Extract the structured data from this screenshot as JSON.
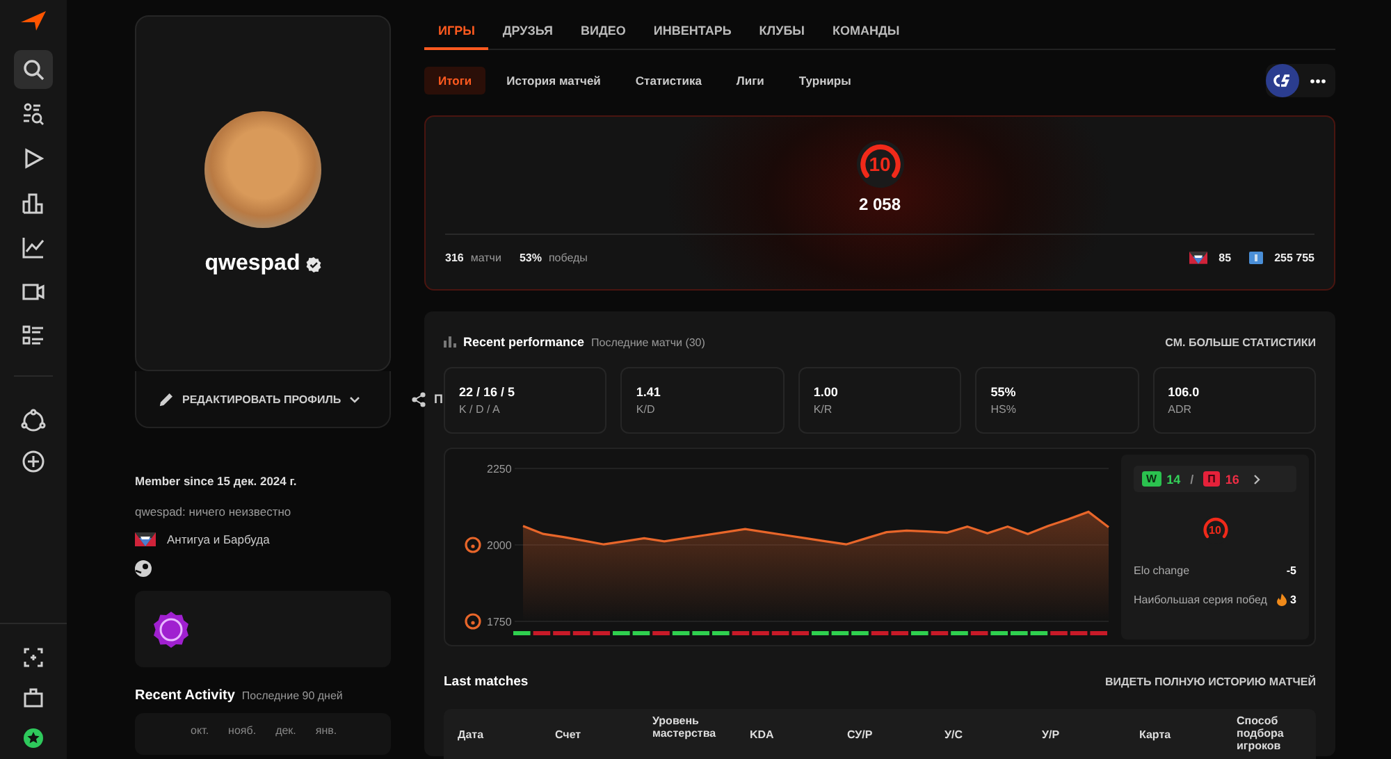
{
  "sidebar": {
    "items": [
      {
        "kind": "search",
        "selected": true
      },
      {
        "kind": "find",
        "selected": false
      },
      {
        "kind": "play",
        "selected": false
      },
      {
        "kind": "ranking",
        "selected": false
      },
      {
        "kind": "stats",
        "selected": false
      },
      {
        "kind": "video",
        "selected": false
      },
      {
        "kind": "list",
        "selected": false
      }
    ],
    "middle_items": [
      {
        "kind": "hub",
        "selected": false
      },
      {
        "kind": "add",
        "selected": false
      }
    ],
    "bottom_items": [
      {
        "kind": "scan",
        "selected": false
      },
      {
        "kind": "bag",
        "selected": false
      },
      {
        "kind": "star",
        "selected": false
      }
    ]
  },
  "profile": {
    "nickname": "qwespad",
    "verified": true,
    "edit_button": "РЕДАКТИРОВАТЬ ПРОФИЛЬ",
    "share_label": "П",
    "member_since": "Member since 15 дек. 2024 г.",
    "bio": "qwespad: ничего неизвестно",
    "country": "Антигуа и Барбуда"
  },
  "recent_activity": {
    "title": "Recent Activity",
    "subtitle": "Последние 90 дней",
    "months": [
      "окт.",
      "нояб.",
      "дек.",
      "янв."
    ]
  },
  "tabs": [
    {
      "label": "ИГРЫ",
      "selected": true
    },
    {
      "label": "ДРУЗЬЯ",
      "selected": false
    },
    {
      "label": "ВИДЕО",
      "selected": false
    },
    {
      "label": "ИНВЕНТАРЬ",
      "selected": false
    },
    {
      "label": "КЛУБЫ",
      "selected": false
    },
    {
      "label": "КОМАНДЫ",
      "selected": false
    }
  ],
  "subtabs": [
    {
      "label": "Итоги",
      "selected": true
    },
    {
      "label": "История матчей",
      "selected": false
    },
    {
      "label": "Статистика",
      "selected": false
    },
    {
      "label": "Лиги",
      "selected": false
    },
    {
      "label": "Турниры",
      "selected": false
    }
  ],
  "elo_card": {
    "level": "10",
    "elo": "2 058",
    "matches": "316",
    "matches_label": "матчи",
    "winrate": "53%",
    "winrate_label": "победы",
    "country_rank": "85",
    "region_rank": "255 755"
  },
  "performance": {
    "title": "Recent performance",
    "subtitle": "Последние матчи (30)",
    "link": "СМ. БОЛЬШЕ СТАТИСТИКИ",
    "stats": [
      {
        "value": "22 / 16 / 5",
        "label": "K / D / A"
      },
      {
        "value": "1.41",
        "label": "K/D"
      },
      {
        "value": "1.00",
        "label": "K/R"
      },
      {
        "value": "55%",
        "label": "HS%"
      },
      {
        "value": "106.0",
        "label": "ADR"
      }
    ],
    "chart_data": {
      "type": "area",
      "series": [
        {
          "color": "#e8662a",
          "values": [
            2062,
            2036,
            2026,
            2014,
            2002,
            2012,
            2022,
            2012,
            2022,
            2032,
            2042,
            2052,
            2042,
            2032,
            2022,
            2012,
            2002,
            2022,
            2042,
            2047,
            2044,
            2040,
            2060,
            2038,
            2060,
            2036,
            2062,
            2084,
            2108,
            2058
          ]
        }
      ],
      "ylim": [
        1750,
        2250
      ],
      "yticks": [
        1750,
        2000,
        2250
      ]
    },
    "results": [
      {
        "win": true
      },
      {
        "win": false
      },
      {
        "win": false
      },
      {
        "win": false
      },
      {
        "win": false
      },
      {
        "win": true
      },
      {
        "win": true
      },
      {
        "win": false
      },
      {
        "win": true
      },
      {
        "win": true
      },
      {
        "win": true
      },
      {
        "win": false
      },
      {
        "win": false
      },
      {
        "win": false
      },
      {
        "win": false
      },
      {
        "win": true
      },
      {
        "win": true
      },
      {
        "win": true
      },
      {
        "win": false
      },
      {
        "win": false
      },
      {
        "win": true
      },
      {
        "win": false
      },
      {
        "win": true
      },
      {
        "win": false
      },
      {
        "win": true
      },
      {
        "win": true
      },
      {
        "win": true
      },
      {
        "win": false
      },
      {
        "win": false
      },
      {
        "win": false
      }
    ],
    "summary": {
      "win_letter": "W",
      "wins": "14",
      "separator": "/",
      "loss_letter": "П",
      "losses": "16",
      "level": "10",
      "elo_change_label": "Elo change",
      "elo_change": "-5",
      "streak_label": "Наибольшая серия побед",
      "streak": "3"
    }
  },
  "last_matches": {
    "title": "Last matches",
    "link": "ВИДЕТЬ ПОЛНУЮ ИСТОРИЮ МАТЧЕЙ",
    "columns": [
      "Дата",
      "Счет",
      "Уровень мастерства",
      "KDA",
      "СУ/Р",
      "У/С",
      "У/Р",
      "Карта",
      "Способ подбора игроков"
    ]
  }
}
